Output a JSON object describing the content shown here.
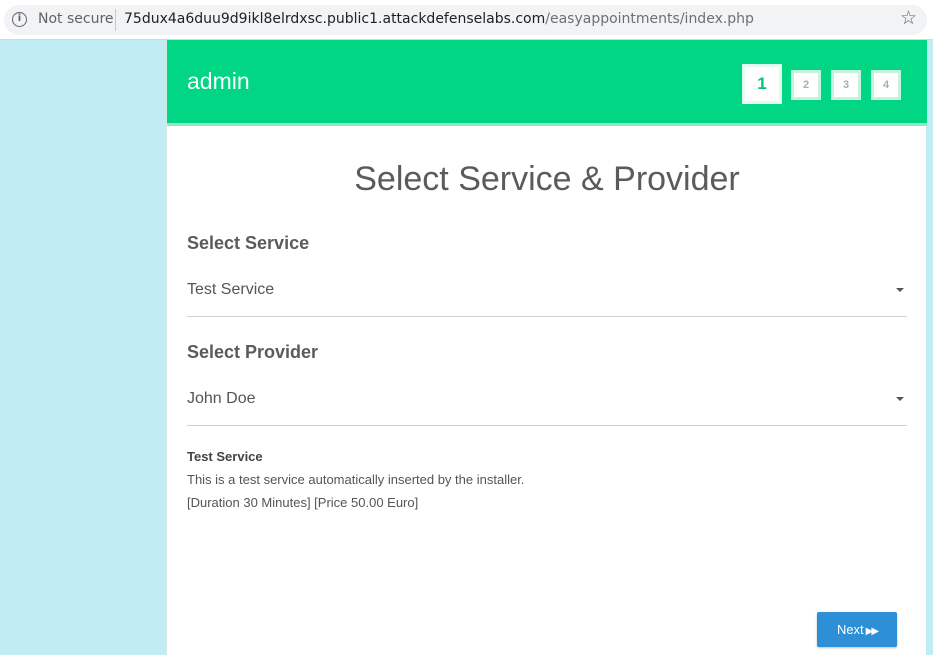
{
  "browser": {
    "security_label": "Not secure",
    "url_host": "75dux4a6duu9d9ikl8elrdxsc.public1.attackdefenselabs.com",
    "url_path": "/easyappointments/index.php"
  },
  "header": {
    "company_name": "admin",
    "steps": [
      "1",
      "2",
      "3",
      "4"
    ],
    "active_step": 1
  },
  "page": {
    "title": "Select Service & Provider"
  },
  "service": {
    "label": "Select Service",
    "selected": "Test Service"
  },
  "provider": {
    "label": "Select Provider",
    "selected": "John Doe"
  },
  "description": {
    "name": "Test Service",
    "text": "This is a test service automatically inserted by the installer.",
    "details": "[Duration 30 Minutes] [Price 50.00 Euro]"
  },
  "actions": {
    "next_label": "Next"
  },
  "colors": {
    "header_bg": "#00d683",
    "page_bg": "#c2ecf3",
    "button_bg": "#2d8fd5"
  }
}
